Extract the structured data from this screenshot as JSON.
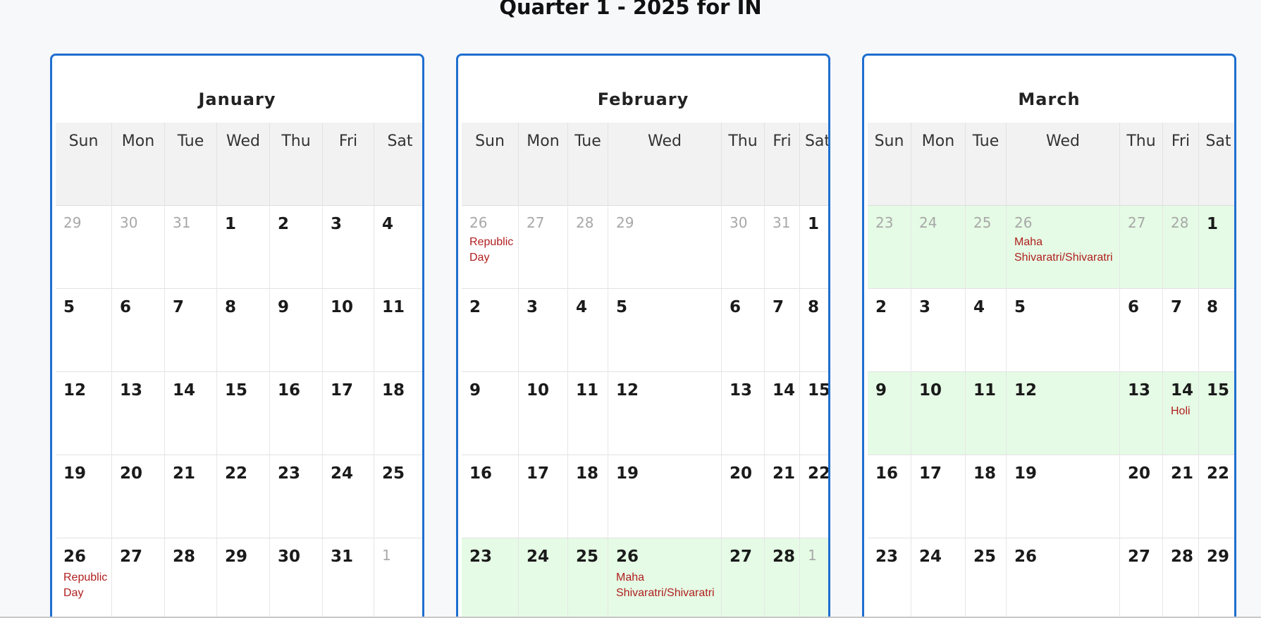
{
  "page": {
    "title": "Quarter 1 - 2025 for IN"
  },
  "colors": {
    "card_border": "#1e6fd0",
    "highlight_week": "#e5fbe5",
    "holiday_text": "#b01e1e",
    "muted_text": "#a8a8a8"
  },
  "months": [
    {
      "name": "January",
      "col_widths": [
        80,
        75,
        74,
        75,
        75,
        73,
        74
      ],
      "weekdays": [
        "Sun",
        "Mon",
        "Tue",
        "Wed",
        "Thu",
        "Fri",
        "Sat"
      ],
      "weeks": [
        {
          "highlight": false,
          "days": [
            {
              "d": "29",
              "muted": true
            },
            {
              "d": "30",
              "muted": true
            },
            {
              "d": "31",
              "muted": true
            },
            {
              "d": "1"
            },
            {
              "d": "2"
            },
            {
              "d": "3"
            },
            {
              "d": "4"
            }
          ]
        },
        {
          "highlight": false,
          "days": [
            {
              "d": "5"
            },
            {
              "d": "6"
            },
            {
              "d": "7"
            },
            {
              "d": "8"
            },
            {
              "d": "9"
            },
            {
              "d": "10"
            },
            {
              "d": "11"
            }
          ]
        },
        {
          "highlight": false,
          "days": [
            {
              "d": "12"
            },
            {
              "d": "13"
            },
            {
              "d": "14"
            },
            {
              "d": "15"
            },
            {
              "d": "16"
            },
            {
              "d": "17"
            },
            {
              "d": "18"
            }
          ]
        },
        {
          "highlight": false,
          "days": [
            {
              "d": "19"
            },
            {
              "d": "20"
            },
            {
              "d": "21"
            },
            {
              "d": "22"
            },
            {
              "d": "23"
            },
            {
              "d": "24"
            },
            {
              "d": "25"
            }
          ]
        },
        {
          "highlight": false,
          "days": [
            {
              "d": "26",
              "holiday": "Republic Day"
            },
            {
              "d": "27"
            },
            {
              "d": "28"
            },
            {
              "d": "29"
            },
            {
              "d": "30"
            },
            {
              "d": "31"
            },
            {
              "d": "1",
              "muted": true
            }
          ]
        }
      ]
    },
    {
      "name": "February",
      "col_widths": [
        81,
        70,
        57,
        161,
        61,
        50,
        51
      ],
      "weekdays": [
        "Sun",
        "Mon",
        "Tue",
        "Wed",
        "Thu",
        "Fri",
        "Sat"
      ],
      "weeks": [
        {
          "highlight": false,
          "days": [
            {
              "d": "26",
              "muted": true,
              "holiday": "Republic Day"
            },
            {
              "d": "27",
              "muted": true
            },
            {
              "d": "28",
              "muted": true
            },
            {
              "d": "29",
              "muted": true
            },
            {
              "d": "30",
              "muted": true
            },
            {
              "d": "31",
              "muted": true
            },
            {
              "d": "1"
            }
          ]
        },
        {
          "highlight": false,
          "days": [
            {
              "d": "2"
            },
            {
              "d": "3"
            },
            {
              "d": "4"
            },
            {
              "d": "5"
            },
            {
              "d": "6"
            },
            {
              "d": "7"
            },
            {
              "d": "8"
            }
          ]
        },
        {
          "highlight": false,
          "days": [
            {
              "d": "9"
            },
            {
              "d": "10"
            },
            {
              "d": "11"
            },
            {
              "d": "12"
            },
            {
              "d": "13"
            },
            {
              "d": "14"
            },
            {
              "d": "15"
            }
          ]
        },
        {
          "highlight": false,
          "days": [
            {
              "d": "16"
            },
            {
              "d": "17"
            },
            {
              "d": "18"
            },
            {
              "d": "19"
            },
            {
              "d": "20"
            },
            {
              "d": "21"
            },
            {
              "d": "22"
            }
          ]
        },
        {
          "highlight": true,
          "days": [
            {
              "d": "23"
            },
            {
              "d": "24"
            },
            {
              "d": "25"
            },
            {
              "d": "26",
              "holiday": "Maha Shivaratri/Shivaratri"
            },
            {
              "d": "27"
            },
            {
              "d": "28"
            },
            {
              "d": "1",
              "muted": true
            }
          ]
        }
      ]
    },
    {
      "name": "March",
      "col_widths": [
        62,
        77,
        58,
        161,
        61,
        51,
        56
      ],
      "weekdays": [
        "Sun",
        "Mon",
        "Tue",
        "Wed",
        "Thu",
        "Fri",
        "Sat"
      ],
      "weeks": [
        {
          "highlight": true,
          "days": [
            {
              "d": "23",
              "muted": true
            },
            {
              "d": "24",
              "muted": true
            },
            {
              "d": "25",
              "muted": true
            },
            {
              "d": "26",
              "muted": true,
              "holiday": "Maha Shivaratri/Shivaratri"
            },
            {
              "d": "27",
              "muted": true
            },
            {
              "d": "28",
              "muted": true
            },
            {
              "d": "1"
            }
          ]
        },
        {
          "highlight": false,
          "days": [
            {
              "d": "2"
            },
            {
              "d": "3"
            },
            {
              "d": "4"
            },
            {
              "d": "5"
            },
            {
              "d": "6"
            },
            {
              "d": "7"
            },
            {
              "d": "8"
            }
          ]
        },
        {
          "highlight": true,
          "days": [
            {
              "d": "9"
            },
            {
              "d": "10"
            },
            {
              "d": "11"
            },
            {
              "d": "12"
            },
            {
              "d": "13"
            },
            {
              "d": "14",
              "holiday": "Holi"
            },
            {
              "d": "15"
            }
          ]
        },
        {
          "highlight": false,
          "days": [
            {
              "d": "16"
            },
            {
              "d": "17"
            },
            {
              "d": "18"
            },
            {
              "d": "19"
            },
            {
              "d": "20"
            },
            {
              "d": "21"
            },
            {
              "d": "22"
            }
          ]
        },
        {
          "highlight": false,
          "days": [
            {
              "d": "23"
            },
            {
              "d": "24"
            },
            {
              "d": "25"
            },
            {
              "d": "26"
            },
            {
              "d": "27"
            },
            {
              "d": "28"
            },
            {
              "d": "29"
            }
          ]
        }
      ]
    }
  ]
}
